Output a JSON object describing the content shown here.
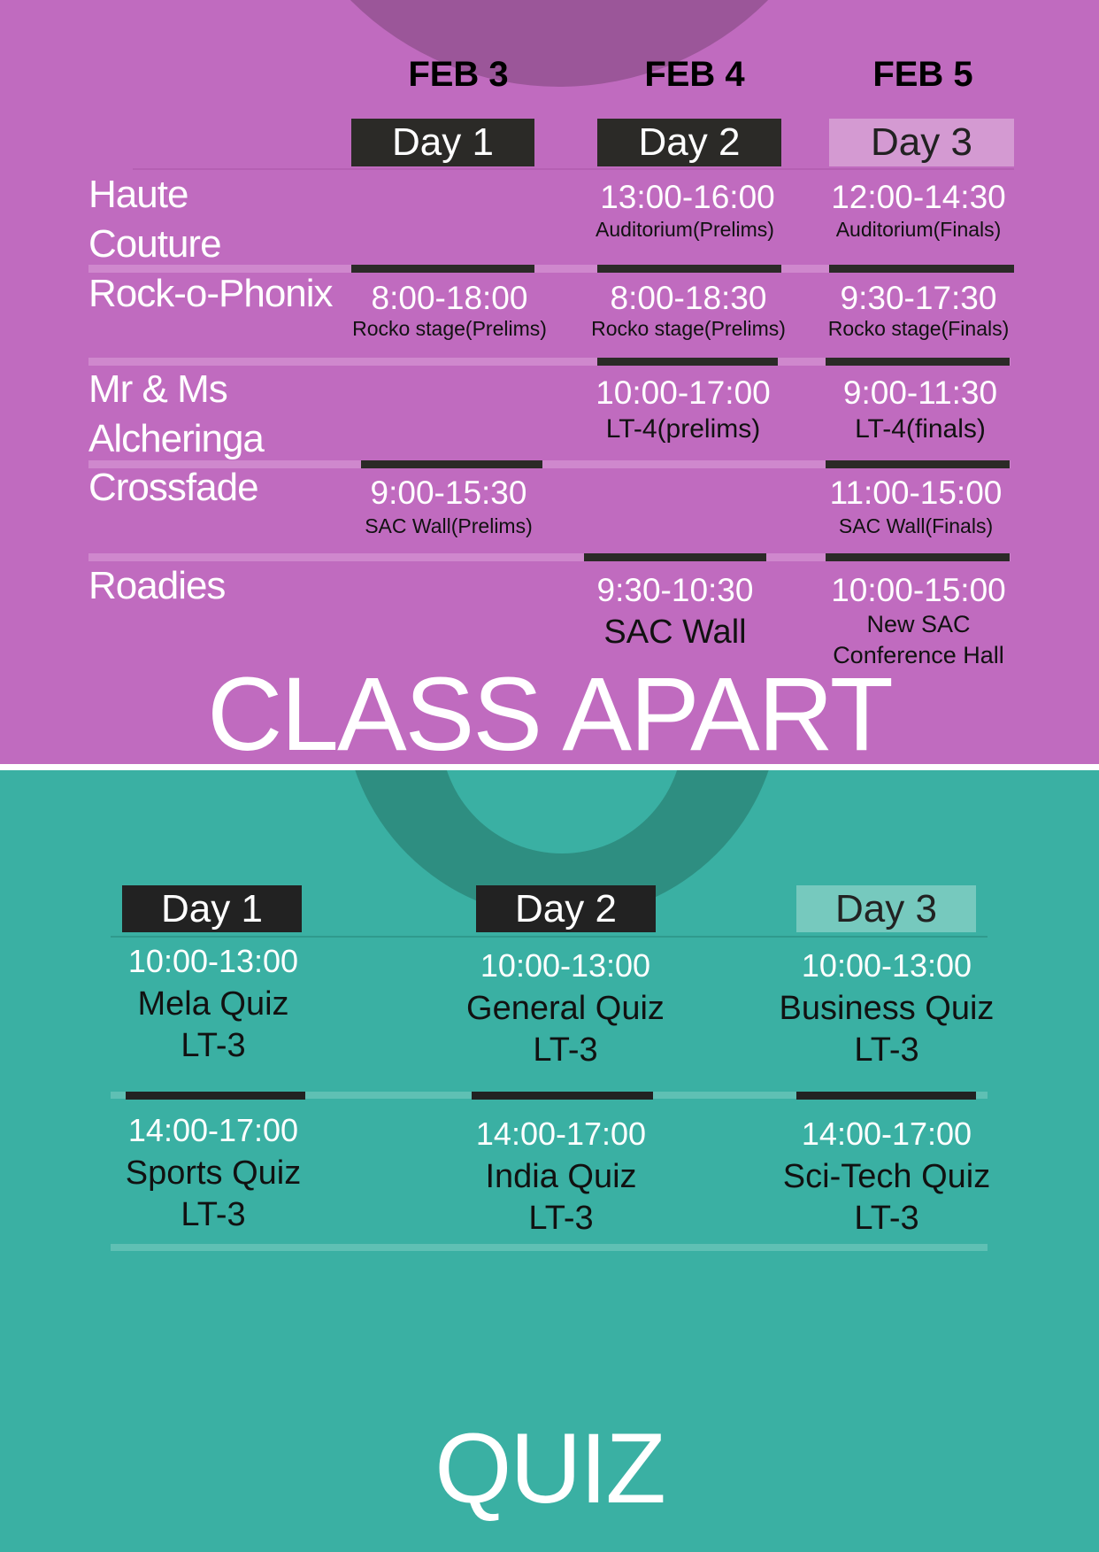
{
  "colors": {
    "purple": "#c06bbf",
    "teal": "#3ab0a3",
    "dark": "#2b2a27"
  },
  "class_apart": {
    "dates": [
      "FEB 3",
      "FEB 4",
      "FEB 5"
    ],
    "days": [
      "Day 1",
      "Day 2",
      "Day 3"
    ],
    "events": [
      {
        "name_lines": [
          "Haute",
          "Couture"
        ],
        "slots": [
          null,
          {
            "time": "13:00-16:00",
            "venue": "Auditorium(Prelims)"
          },
          {
            "time": "12:00-14:30",
            "venue": "Auditorium(Finals)"
          }
        ]
      },
      {
        "name_lines": [
          "Rock-o-Phonix"
        ],
        "slots": [
          {
            "time": "8:00-18:00",
            "venue": "Rocko stage(Prelims)"
          },
          {
            "time": "8:00-18:30",
            "venue": "Rocko stage(Prelims)"
          },
          {
            "time": "9:30-17:30",
            "venue": "Rocko stage(Finals)"
          }
        ]
      },
      {
        "name_lines": [
          "Mr & Ms",
          "Alcheringa"
        ],
        "slots": [
          null,
          {
            "time": "10:00-17:00",
            "venue": "LT-4(prelims)"
          },
          {
            "time": "9:00-11:30",
            "venue": "LT-4(finals)"
          }
        ]
      },
      {
        "name_lines": [
          "Crossfade"
        ],
        "slots": [
          {
            "time": "9:00-15:30",
            "venue": "SAC Wall(Prelims)"
          },
          null,
          {
            "time": "11:00-15:00",
            "venue": "SAC Wall(Finals)"
          }
        ]
      },
      {
        "name_lines": [
          "Roadies"
        ],
        "slots": [
          null,
          {
            "time": "9:30-10:30",
            "venue": "SAC Wall"
          },
          {
            "time": "10:00-15:00",
            "venue_lines": [
              "New SAC",
              "Conference Hall"
            ]
          }
        ]
      }
    ],
    "title": "CLASS APART"
  },
  "quiz": {
    "days": [
      "Day 1",
      "Day 2",
      "Day 3"
    ],
    "rows": [
      [
        {
          "time": "10:00-13:00",
          "name": "Mela Quiz",
          "venue": "LT-3"
        },
        {
          "time": "10:00-13:00",
          "name": "General Quiz",
          "venue": "LT-3"
        },
        {
          "time": "10:00-13:00",
          "name": "Business Quiz",
          "venue": "LT-3"
        }
      ],
      [
        {
          "time": "14:00-17:00",
          "name": "Sports Quiz",
          "venue": "LT-3"
        },
        {
          "time": "14:00-17:00",
          "name": "India Quiz",
          "venue": "LT-3"
        },
        {
          "time": "14:00-17:00",
          "name": "Sci-Tech Quiz",
          "venue": "LT-3"
        }
      ]
    ],
    "title": "QUIZ"
  }
}
